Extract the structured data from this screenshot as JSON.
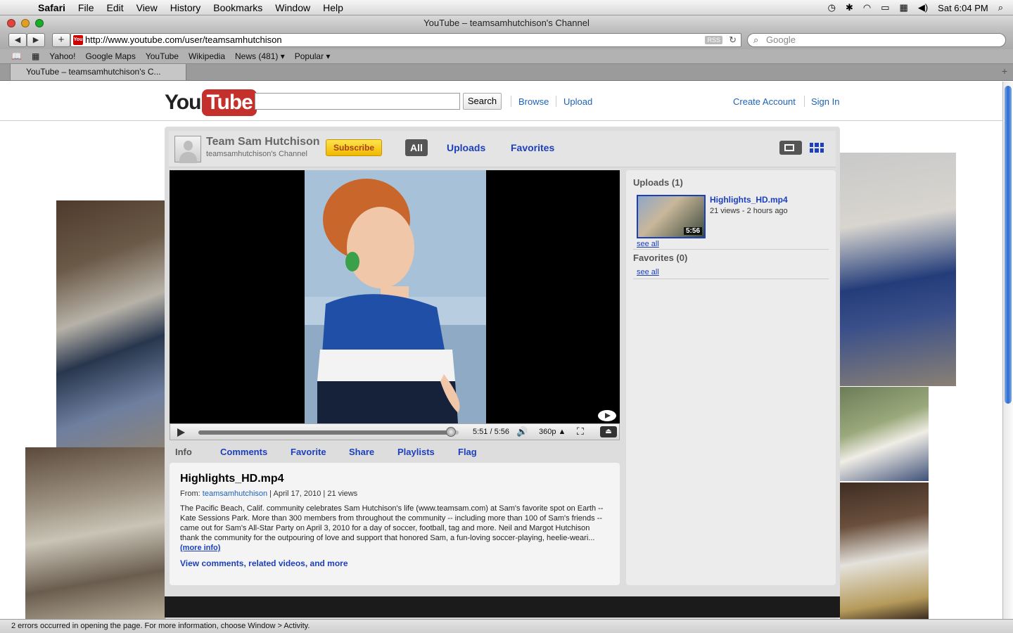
{
  "menubar": {
    "app": "Safari",
    "items": [
      "File",
      "Edit",
      "View",
      "History",
      "Bookmarks",
      "Window",
      "Help"
    ],
    "clock": "Sat 6:04 PM"
  },
  "window": {
    "title": "YouTube – teamsamhutchison's Channel"
  },
  "toolbar": {
    "url": "http://www.youtube.com/user/teamsamhutchison",
    "rss": "RSS",
    "search_placeholder": "Google"
  },
  "bookmarks": [
    "Yahoo!",
    "Google Maps",
    "YouTube",
    "Wikipedia",
    "News (481) ▾",
    "Popular ▾"
  ],
  "tab": {
    "label": "YouTube – teamsamhutchison's C..."
  },
  "youtube": {
    "logo_you": "You",
    "logo_tube": "Tube",
    "search_button": "Search",
    "nav": [
      "Browse",
      "Upload"
    ],
    "account": [
      "Create Account",
      "Sign In"
    ]
  },
  "channel": {
    "name": "Team Sam Hutchison",
    "subtitle": "teamsamhutchison's Channel",
    "subscribe": "Subscribe",
    "tabs": [
      "All",
      "Uploads",
      "Favorites"
    ]
  },
  "player": {
    "time": "5:51 / 5:56",
    "quality": "360p",
    "progress": 0.97
  },
  "info_tabs": [
    "Info",
    "Comments",
    "Favorite",
    "Share",
    "Playlists",
    "Flag"
  ],
  "video": {
    "title": "Highlights_HD.mp4",
    "from_label": "From:",
    "from_user": "teamsamhutchison",
    "meta_rest": " | April 17, 2010 | 21 views",
    "description": "The Pacific Beach, Calif. community celebrates Sam Hutchison's life (www.teamsam.com) at Sam's favorite spot on Earth -- Kate Sessions Park. More than 300 members from throughout the community -- including more than 100 of Sam's friends -- came out for Sam's All-Star Party on April 3, 2010 for a day of soccer, football, tag and more. Neil and Margot Hutchison thank the community for the outpouring of love and support that honored Sam, a fun-loving soccer-playing, heelie-weari...",
    "more_info": "(more info)",
    "view_more": "View comments, related videos, and more"
  },
  "sidebar": {
    "uploads_heading": "Uploads (1)",
    "upload_title": "Highlights_HD.mp4",
    "upload_meta": "21 views - 2 hours ago",
    "upload_duration": "5:56",
    "see_all": "see all",
    "favorites_heading": "Favorites (0)"
  },
  "status": "2 errors occurred in opening the page. For more information, choose Window > Activity."
}
